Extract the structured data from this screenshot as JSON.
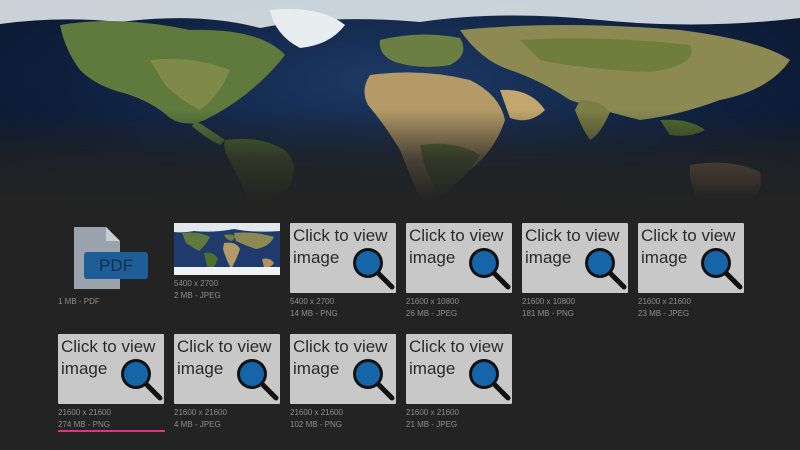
{
  "hero": {
    "image": "world-map-banner"
  },
  "files": [
    {
      "kind": "pdf",
      "icon_label": "PDF",
      "meta": [
        "1 MB - PDF"
      ]
    },
    {
      "kind": "preview",
      "meta": [
        "5400 x 2700",
        "2 MB - JPEG"
      ]
    },
    {
      "kind": "placeholder",
      "line1": "Click to view",
      "line2": "image",
      "meta": [
        "5400 x 2700",
        "14 MB - PNG"
      ]
    },
    {
      "kind": "placeholder",
      "line1": "Click to view",
      "line2": "image",
      "meta": [
        "21600 x 10800",
        "26 MB - JPEG"
      ]
    },
    {
      "kind": "placeholder",
      "line1": "Click to view",
      "line2": "image",
      "meta": [
        "21600 x 10800",
        "181 MB - PNG"
      ]
    },
    {
      "kind": "placeholder",
      "line1": "Click to view",
      "line2": "image",
      "meta": [
        "21600 x 21600",
        "23 MB - JPEG"
      ]
    },
    {
      "kind": "placeholder",
      "line1": "Click to view",
      "line2": "image",
      "meta": [
        "21600 x 21600",
        "274 MB - PNG"
      ],
      "focused": true
    },
    {
      "kind": "placeholder",
      "line1": "Click to view",
      "line2": "image",
      "meta": [
        "21600 x 21600",
        "4 MB - JPEG"
      ]
    },
    {
      "kind": "placeholder",
      "line1": "Click to view",
      "line2": "image",
      "meta": [
        "21600 x 21600",
        "102 MB - PNG"
      ]
    },
    {
      "kind": "placeholder",
      "line1": "Click to view",
      "line2": "image",
      "meta": [
        "21600 x 21600",
        "21 MB - JPEG"
      ]
    }
  ],
  "colors": {
    "background": "#232323",
    "placeholder": "#c8c8c8",
    "magnifier": "#1565a8",
    "pdf_icon": "#9aa3ac",
    "pdf_badge": "#1d5e97",
    "focus": "#d9387a"
  }
}
